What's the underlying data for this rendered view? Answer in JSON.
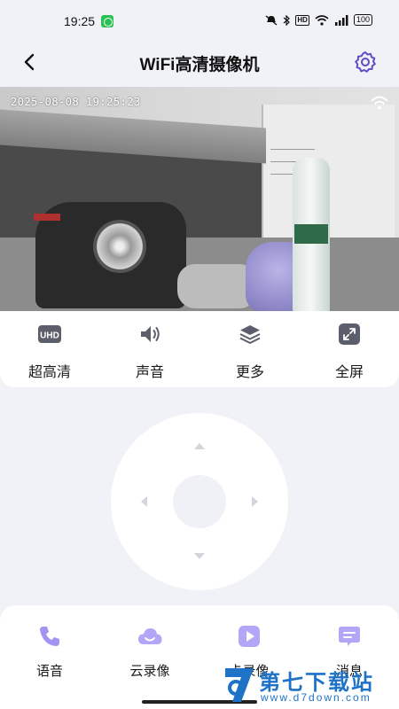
{
  "status_bar": {
    "time": "19:25",
    "network_badge": "HD",
    "battery": "100"
  },
  "header": {
    "title": "WiFi高清摄像机"
  },
  "video": {
    "timestamp": "2025-08-08 19:25:23"
  },
  "controls": [
    {
      "label": "超高清",
      "icon": "uhd-icon",
      "badge": "UHD"
    },
    {
      "label": "声音",
      "icon": "speaker-icon"
    },
    {
      "label": "更多",
      "icon": "layers-icon"
    },
    {
      "label": "全屏",
      "icon": "fullscreen-icon"
    }
  ],
  "bottom_nav": [
    {
      "label": "语音",
      "icon": "phone-icon"
    },
    {
      "label": "云录像",
      "icon": "cloud-icon"
    },
    {
      "label": "卡录像",
      "icon": "play-icon"
    },
    {
      "label": "消息",
      "icon": "message-icon"
    }
  ],
  "watermark": {
    "text": "第七下载站",
    "url": "www.d7down.com"
  },
  "colors": {
    "accent": "#8e7cf0",
    "background": "#f1f2f7",
    "watermark": "#1e73c8"
  }
}
